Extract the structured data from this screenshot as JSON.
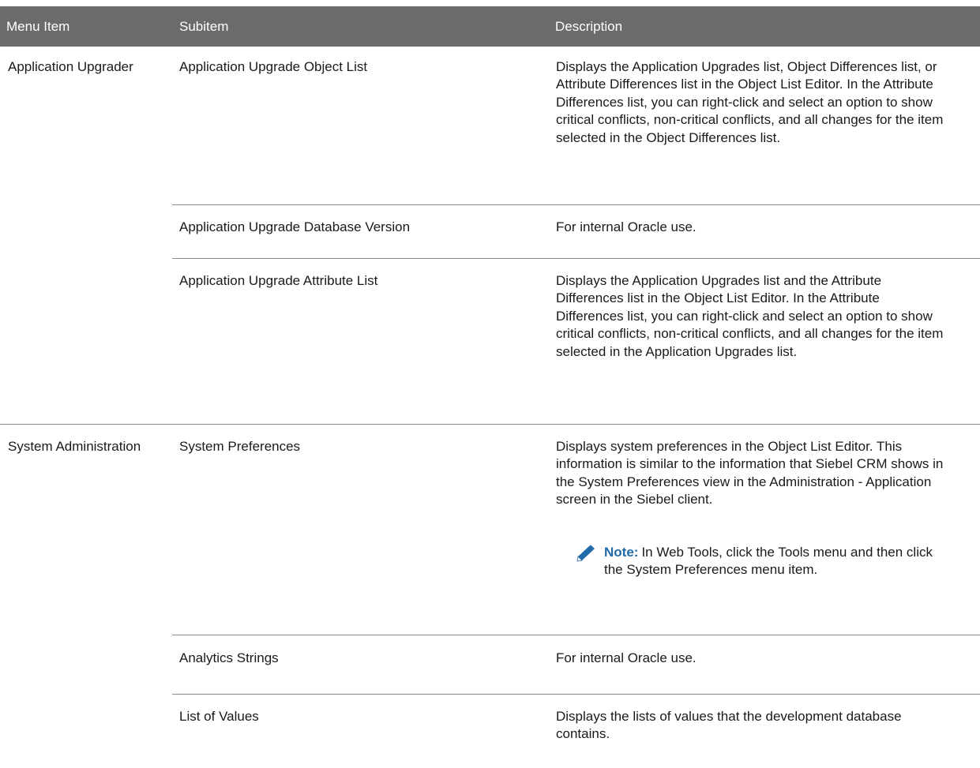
{
  "header": {
    "menu_item": "Menu Item",
    "subitem": "Subitem",
    "description": "Description"
  },
  "groups": [
    {
      "menu_item": "Application Upgrader",
      "rows": [
        {
          "subitem": "Application Upgrade Object List",
          "description": "Displays the Application Upgrades list, Object Differences list, or Attribute Differences list in the Object List Editor. In the Attribute Differences list, you can right-click and select an option to show critical conflicts, non-critical conflicts, and all changes for the item selected in the Object Differences list."
        },
        {
          "subitem": "Application Upgrade Database Version",
          "description": "For internal Oracle use."
        },
        {
          "subitem": "Application Upgrade Attribute List",
          "description": "Displays the Application Upgrades list and the Attribute Differences list in the Object List Editor. In the Attribute Differences list, you can right-click and select an option to show critical conflicts, non-critical conflicts, and all changes for the item selected in the Application Upgrades list."
        }
      ]
    },
    {
      "menu_item": "System Administration",
      "rows": [
        {
          "subitem": "System Preferences",
          "description": "Displays system preferences in the Object List Editor. This information is similar to the information that Siebel CRM shows in the System Preferences view in the Administration - Application screen in the Siebel client.",
          "note_label": "Note:",
          "note_text": "In Web Tools, click the Tools menu and then click the System Preferences menu item.",
          "note_icon": "pencil-icon"
        },
        {
          "subitem": "Analytics Strings",
          "description": "For internal Oracle use."
        },
        {
          "subitem": "List of Values",
          "description": "Displays the lists of values that the development database contains."
        }
      ]
    }
  ],
  "colors": {
    "header_bg": "#6b6b6b",
    "header_text": "#ffffff",
    "note_label": "#1f6aa8",
    "rule": "#8a8a8a"
  }
}
